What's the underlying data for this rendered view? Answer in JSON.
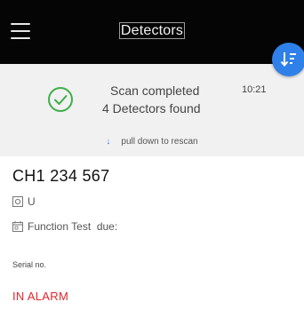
{
  "header": {
    "title": "Detectors",
    "menu_icon": "hamburger-menu-icon",
    "sort_icon": "sort-list-icon",
    "accent_color": "#2f80e8"
  },
  "scan": {
    "status": "Scan completed",
    "time": "10:21",
    "detail": "4 Detectors found",
    "status_icon": "check-circle-icon",
    "check_color": "#3dae49",
    "pull_hint": "pull down to rescan"
  },
  "detector": {
    "name": "CH1 234 567",
    "type_value": "U",
    "type_icon": "square-badge-icon",
    "function_test_label": "Function Test  due:",
    "calendar_icon": "calendar-icon",
    "serial_label": "Serial no.",
    "alarm_status": "IN ALARM",
    "alarm_color": "#e0262f"
  }
}
